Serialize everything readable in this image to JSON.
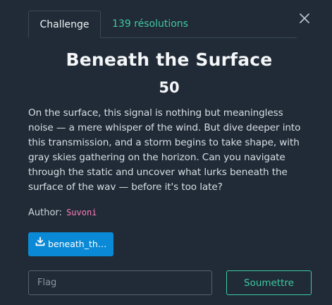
{
  "tabs": {
    "challenge_label": "Challenge",
    "solves_label": "139 résolutions"
  },
  "challenge": {
    "title": "Beneath the Surface",
    "points": "50",
    "description": "On the surface, this signal is nothing but meaningless noise — a mere whisper of the wind. But dive deeper into this transmission, and a storm begins to take shape, with gray skies gathering on the horizon. Can you navigate through the static and uncover what lurks beneath the surface of the wav — before it's too late?",
    "author_label": "Author:",
    "author_name": "Suvoni",
    "file_label": "beneath_th…"
  },
  "form": {
    "flag_placeholder": "Flag",
    "flag_value": "",
    "submit_label": "Soumettre"
  },
  "icons": {
    "close": "close-icon",
    "download": "download-icon"
  },
  "colors": {
    "background": "#202b37",
    "accent_green": "#3fc9a2",
    "file_button_blue": "#0a8ad6",
    "author_pink": "#ff7eb6"
  }
}
